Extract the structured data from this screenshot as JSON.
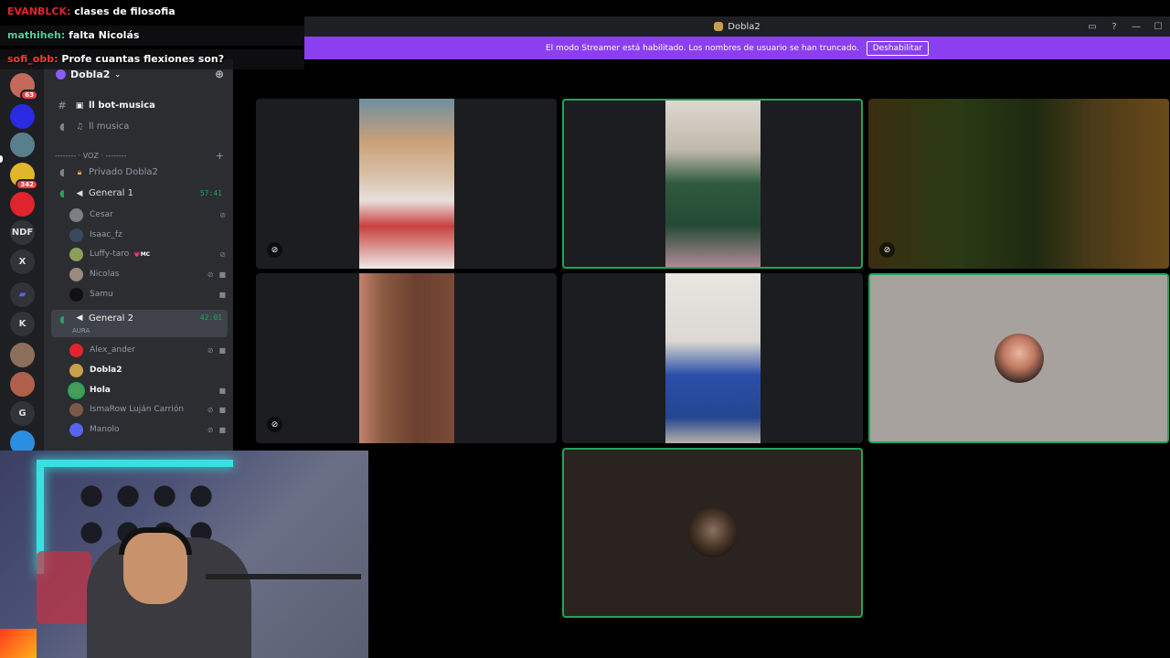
{
  "window": {
    "title": "Dobla2",
    "inbox_icon": "inbox-icon",
    "help_icon": "help-icon",
    "minimize_glyph": "—",
    "maximize_glyph": "☐"
  },
  "banner": {
    "text": "El modo Streamer está habilitado. Los nombres de usuario se han truncado.",
    "button_label": "Deshabilitar",
    "color": "#8b3ff0"
  },
  "chat": [
    {
      "user": "EVANBLCK:",
      "message": "clases de filosofia",
      "color": "#e0252e"
    },
    {
      "user": "mathiheh:",
      "message": "falta Nicolás",
      "color": "#4fd19a"
    },
    {
      "user": "sofi_obb:",
      "message": "Profe cuantas flexiones son?",
      "color": "#ff3a3a"
    }
  ],
  "rail": {
    "servers": [
      {
        "label": "",
        "badge": "63",
        "color": "#c46a5a"
      },
      {
        "label": "",
        "badge": "",
        "color": "#2a2ae0"
      },
      {
        "label": "",
        "badge": "",
        "color": "#5a7f8c"
      },
      {
        "label": "",
        "badge": "342",
        "color": "#e0b72a"
      },
      {
        "label": "",
        "badge": "",
        "color": "#e0242e"
      },
      {
        "label": "NDF",
        "badge": "",
        "color": "#313338"
      },
      {
        "label": "X",
        "badge": "",
        "color": "#313338"
      },
      {
        "label": "▰",
        "badge": "",
        "color": "#313338"
      },
      {
        "label": "K",
        "badge": "",
        "color": "#313338"
      },
      {
        "label": "",
        "badge": "",
        "color": "#8c6f5a"
      },
      {
        "label": "",
        "badge": "",
        "color": "#b0604a"
      },
      {
        "label": "G",
        "badge": "",
        "color": "#313338"
      },
      {
        "label": "",
        "badge": "",
        "color": "#2a8fe0"
      }
    ]
  },
  "sidebar": {
    "guild_name": "Dobla2",
    "channels": {
      "bot_musica": "ll bot-musica",
      "musica": "ll musica",
      "voice_category": "-------- · VOZ · --------",
      "privado": "Privado Dobla2",
      "general1": {
        "name": "General 1",
        "timer": "57:41"
      },
      "general1_users": [
        {
          "name": "Cesar",
          "avatar": "#7a7f86",
          "tag": "",
          "muted": true,
          "video": false
        },
        {
          "name": "Isaac_fz",
          "avatar": "#3a4a5e",
          "tag": "",
          "muted": false,
          "video": false
        },
        {
          "name": "Luffy-taro",
          "avatar": "#8ca05a",
          "tag": "💗MC",
          "muted": true,
          "video": false
        },
        {
          "name": "Nicolas",
          "avatar": "#9a8a80",
          "tag": "",
          "muted": true,
          "video": true
        },
        {
          "name": "Samu",
          "avatar": "#1a1a1a",
          "tag": "",
          "muted": false,
          "video": true
        }
      ],
      "general2": {
        "name": "General 2",
        "timer": "42:01",
        "status": "AURA"
      },
      "general2_users": [
        {
          "name": "Alex_ander",
          "avatar": "#e0242e",
          "muted": true,
          "video": true,
          "bold": false
        },
        {
          "name": "Dobla2",
          "avatar": "#c9a04a",
          "muted": false,
          "video": false,
          "bold": true
        },
        {
          "name": "Hola",
          "avatar": "#4a9a5a",
          "muted": false,
          "video": true,
          "bold": true
        },
        {
          "name": "IsmaRow Luján Carrión",
          "avatar": "#7a5a4a",
          "muted": true,
          "video": true,
          "bold": false
        },
        {
          "name": "Manolo",
          "avatar": "#5865f2",
          "muted": true,
          "video": true,
          "bold": false
        }
      ]
    }
  },
  "grid": {
    "tiles": [
      {
        "id": "tile-1",
        "muted": true,
        "speaking": false,
        "kind": "camera"
      },
      {
        "id": "tile-2",
        "muted": false,
        "speaking": true,
        "kind": "camera"
      },
      {
        "id": "tile-3",
        "muted": true,
        "speaking": false,
        "kind": "camera"
      },
      {
        "id": "tile-4",
        "muted": true,
        "speaking": false,
        "kind": "camera"
      },
      {
        "id": "tile-5",
        "muted": false,
        "speaking": false,
        "kind": "camera"
      },
      {
        "id": "tile-6",
        "muted": false,
        "speaking": true,
        "kind": "avatar"
      },
      {
        "id": "tile-7",
        "muted": false,
        "speaking": true,
        "kind": "avatar"
      }
    ]
  },
  "colors": {
    "speaking": "#23a55a",
    "timer": "#23a55a",
    "sidebar_bg": "#2b2d31",
    "rail_bg": "#1e1f22"
  }
}
